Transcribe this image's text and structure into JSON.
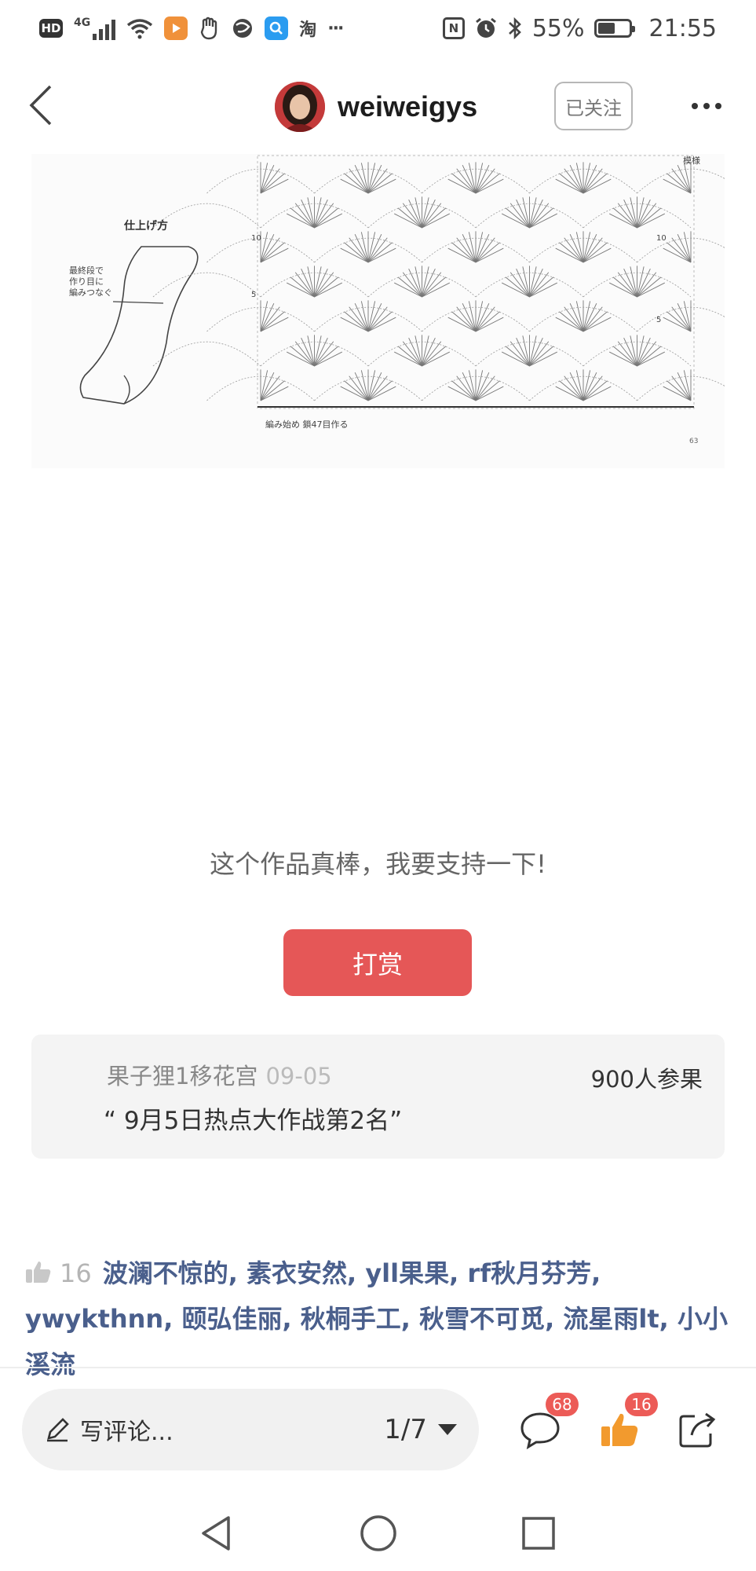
{
  "status_bar": {
    "hd_label": "HD",
    "network_label": "4G",
    "taobao_glyph": "淘",
    "more_glyph": "···",
    "nfc_label": "N",
    "battery_percent_text": "55%",
    "battery_level": 0.55,
    "time": "21:55"
  },
  "header": {
    "author_name": "weiweigys",
    "follow_label": "已关注"
  },
  "pattern_image": {
    "finish_title": "仕上げ方",
    "finish_note_1": "最終段で",
    "finish_note_2": "作り目に",
    "finish_note_3": "編みつなぐ",
    "footer_note": "編み始め 鎖47目作る",
    "side_label": "模様",
    "row_10": "10",
    "row_5": "5",
    "left_10": "10",
    "left_5": "5",
    "corner_mark": "63"
  },
  "reward": {
    "text": "这个作品真棒，我要支持一下!",
    "button_label": "打赏"
  },
  "contest_card": {
    "source": "果子狸1移花宫",
    "date": "09-05",
    "quote": "“ 9月5日热点大作战第2名”",
    "participants": "900人参果"
  },
  "likes": {
    "count": "16",
    "names": "波澜不惊的, 素衣安然, yll果果, rf秋月芬芳, ywykthnn, 颐弘佳丽, 秋桐手工, 秋雪不可觅, 流星雨lt, 小小溪流"
  },
  "bottom_bar": {
    "comment_placeholder": "写评论...",
    "page_indicator": "1/7",
    "comment_count": "68",
    "like_count": "16"
  },
  "colors": {
    "accent_red": "#e55757",
    "badge_red": "#ec5b57",
    "like_orange": "#f29a2e",
    "name_blue": "#4a5f8c"
  },
  "icons": [
    "back-arrow-icon",
    "more-dots-icon",
    "pencil-icon",
    "chevron-down-icon",
    "comment-bubble-icon",
    "thumbs-up-icon",
    "share-icon",
    "nav-back-icon",
    "nav-home-icon",
    "nav-recents-icon"
  ]
}
